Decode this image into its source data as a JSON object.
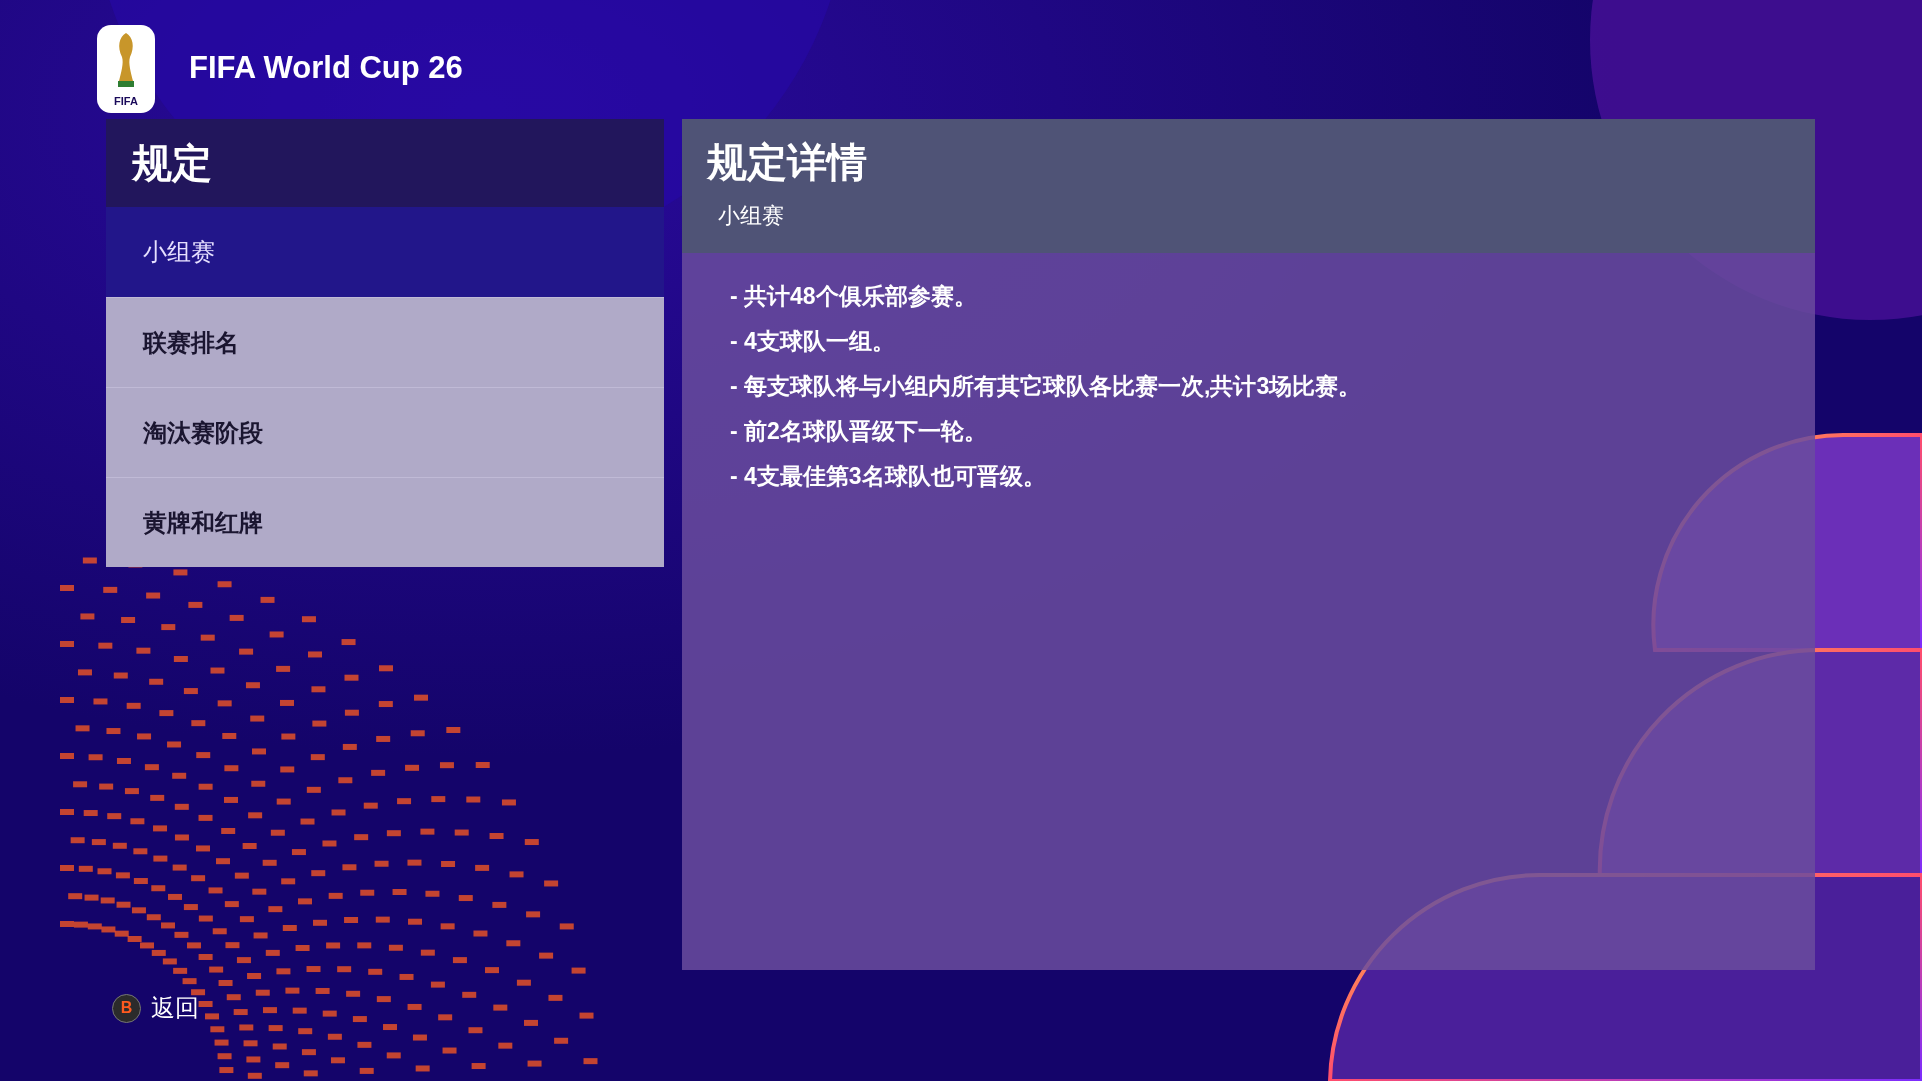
{
  "header": {
    "logo_text": "FIFA",
    "title": "FIFA World Cup 26"
  },
  "rules_menu": {
    "title": "规定",
    "items": [
      {
        "label": "小组赛",
        "selected": true
      },
      {
        "label": "联赛排名",
        "selected": false
      },
      {
        "label": "淘汰赛阶段",
        "selected": false
      },
      {
        "label": "黄牌和红牌",
        "selected": false
      }
    ]
  },
  "details": {
    "title": "规定详情",
    "subtitle": "小组赛",
    "lines": [
      "- 共计48个俱乐部参赛。",
      "- 4支球队一组。",
      "- 每支球队将与小组内所有其它球队各比赛一次,共计3场比赛。",
      "- 前2名球队晋级下一轮。",
      "- 4支最佳第3名球队也可晋级。"
    ]
  },
  "footer": {
    "back_key": "B",
    "back_label": "返回"
  }
}
